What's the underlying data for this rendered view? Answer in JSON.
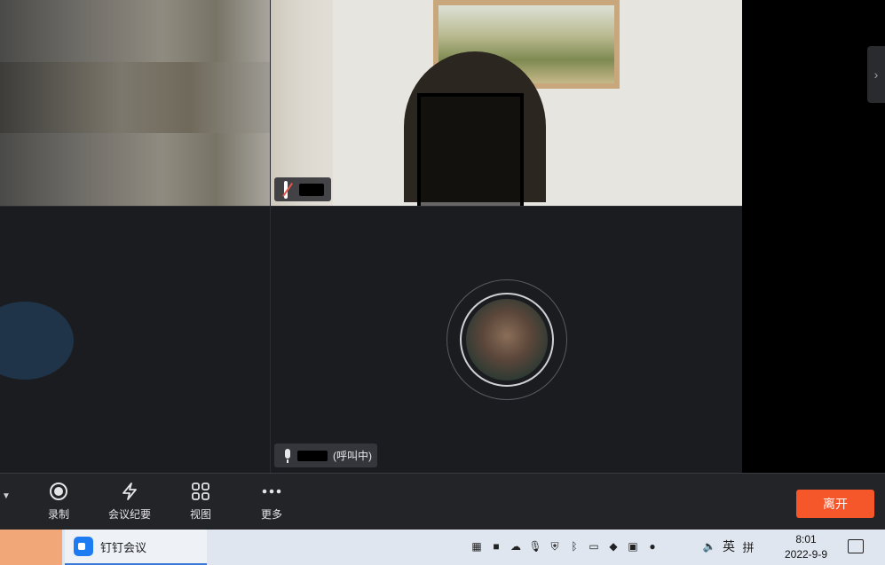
{
  "toolbar": {
    "buttons": [
      {
        "label": "录制",
        "icon": "record-icon"
      },
      {
        "label": "会议纪要",
        "icon": "minutes-icon"
      },
      {
        "label": "视图",
        "icon": "grid-view-icon"
      },
      {
        "label": "更多",
        "icon": "more-icon"
      }
    ],
    "leave_label": "离开"
  },
  "participants": {
    "calling_status": "(呼叫中)"
  },
  "taskbar": {
    "app_label": "钉钉会议",
    "ime_lang": "英",
    "ime_mode": "拼",
    "time": "8:01",
    "date": "2022-9-9"
  },
  "colors": {
    "leave_button": "#f5562a",
    "toolbar_bg": "#232428",
    "tile_bg": "#1b1c20"
  }
}
